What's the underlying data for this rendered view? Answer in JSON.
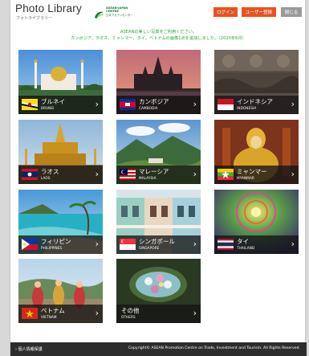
{
  "header": {
    "title": "Photo Library",
    "subtitle": "フォトライブラリー",
    "logo_line1": "ASEAN-JAPAN CENTRE",
    "logo_line2": "日本アセアンセンター",
    "login_label": "ログイン",
    "register_label": "ユーザー登録",
    "close_label": "閉じる"
  },
  "notice": {
    "line1": "ASEANの美しい写真をご利用ください。",
    "line2": "カンボジア、ラオス、ミャンマー、タイ、ベトナムの画像1点を追加しました。（2020年6月）"
  },
  "countries": [
    {
      "jp": "ブルネイ",
      "en": "BRUNEI",
      "flag": "brunei-flag-icon",
      "photo": "mosque-photo"
    },
    {
      "jp": "カンボジア",
      "en": "CAMBODIA",
      "flag": "cambodia-flag-icon",
      "photo": "angkor-wat-photo"
    },
    {
      "jp": "インドネシア",
      "en": "INDONESIA",
      "flag": "indonesia-flag-icon",
      "photo": "temple-relief-photo"
    },
    {
      "jp": "ラオス",
      "en": "LAOS",
      "flag": "laos-flag-icon",
      "photo": "golden-stupa-photo"
    },
    {
      "jp": "マレーシア",
      "en": "MALAYSIA",
      "flag": "malaysia-flag-icon",
      "photo": "mountain-valley-photo"
    },
    {
      "jp": "ミャンマー",
      "en": "MYANMAR",
      "flag": "myanmar-flag-icon",
      "photo": "buddha-statue-photo"
    },
    {
      "jp": "フィリピン",
      "en": "PHILIPPINES",
      "flag": "philippines-flag-icon",
      "photo": "beach-lagoon-photo"
    },
    {
      "jp": "シンガポール",
      "en": "SINGAPORE",
      "flag": "singapore-flag-icon",
      "photo": "shophouses-photo"
    },
    {
      "jp": "タイ",
      "en": "THAILAND",
      "flag": "thailand-flag-icon",
      "photo": "temple-ceiling-photo"
    },
    {
      "jp": "ベトナム",
      "en": "VIETNAM",
      "flag": "vietnam-flag-icon",
      "photo": "dancers-photo"
    },
    {
      "jp": "その他",
      "en": "OTHERS",
      "flag": "",
      "photo": "flower-bowl-photo"
    }
  ],
  "chevron": "›",
  "footer": {
    "privacy": "› 個人情報保護",
    "copyright": "Copyright© ASEAN Promotion Centre on Trade, Investment and Tourism. All Rights Reserved."
  },
  "colors": {
    "accent": "#e8531e",
    "notice_green": "#2ea23a",
    "close_gray": "#9a9a9a",
    "footer_bg": "#2d2d2d"
  }
}
